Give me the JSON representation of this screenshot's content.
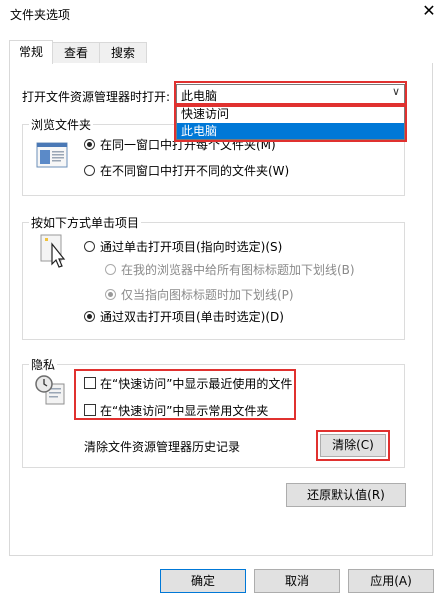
{
  "window": {
    "title": "文件夹选项",
    "close_glyph": "✕"
  },
  "tabs": [
    {
      "label": "常规",
      "active": true
    },
    {
      "label": "查看",
      "active": false
    },
    {
      "label": "搜索",
      "active": false
    }
  ],
  "open_in": {
    "label": "打开文件资源管理器时打开:",
    "selected": "此电脑",
    "arrow": "∨",
    "options": [
      "快速访问",
      "此电脑"
    ],
    "highlighted_option": "此电脑"
  },
  "browse_folders": {
    "title": "浏览文件夹",
    "icon": "window-folder-icon",
    "options": [
      {
        "label": "在同一窗口中打开每个文件夹(M)",
        "checked": true
      },
      {
        "label": "在不同窗口中打开不同的文件夹(W)",
        "checked": false
      }
    ]
  },
  "click_items": {
    "title": "按如下方式单击项目",
    "icon": "cursor-click-icon",
    "single_click": {
      "label": "通过单击打开项目(指向时选定)(S)",
      "checked": false
    },
    "underline_all": {
      "label": "在我的浏览器中给所有图标标题加下划线(B)",
      "checked": false,
      "disabled": true
    },
    "underline_hover": {
      "label": "仅当指向图标标题时加下划线(P)",
      "checked": true,
      "disabled": true
    },
    "double_click": {
      "label": "通过双击打开项目(单击时选定)(D)",
      "checked": true
    }
  },
  "privacy": {
    "title": "隐私",
    "icon": "privacy-clock-icon",
    "show_recent_files": {
      "label": "在“快速访问”中显示最近使用的文件",
      "checked": false
    },
    "show_frequent_folders": {
      "label": "在“快速访问”中显示常用文件夹",
      "checked": false
    },
    "clear_history_label": "清除文件资源管理器历史记录",
    "clear_button": "清除(C)"
  },
  "restore_defaults_button": "还原默认值(R)",
  "footer": {
    "ok": "确定",
    "cancel": "取消",
    "apply": "应用(A)"
  },
  "colors": {
    "highlight_red": "#e0312f",
    "selection_blue": "#0078d7",
    "button_face": "#e1e1e1"
  }
}
